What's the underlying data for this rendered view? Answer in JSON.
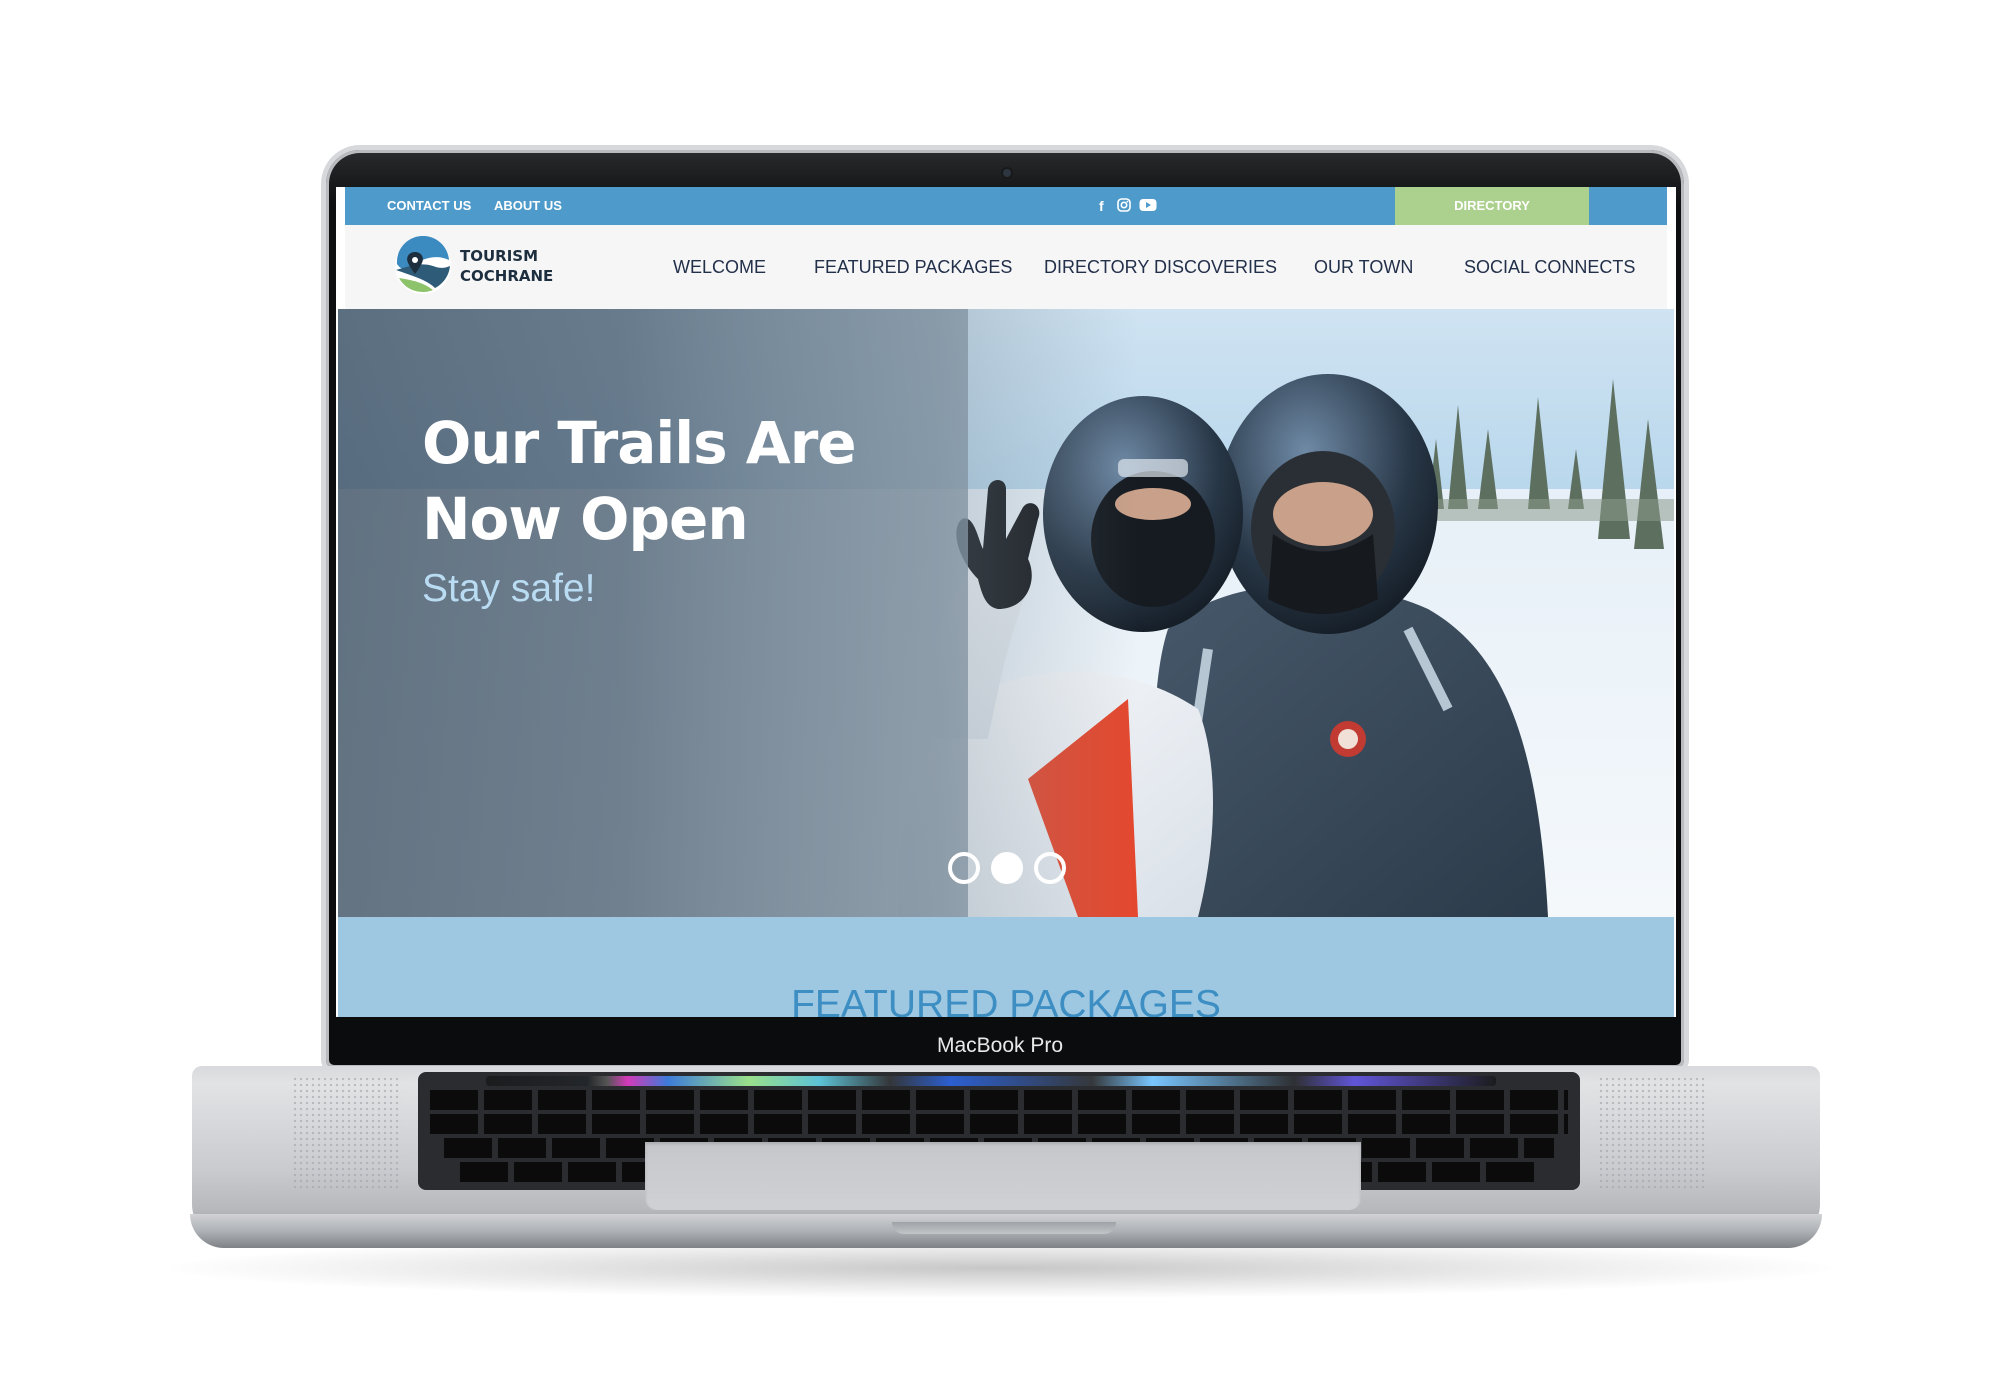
{
  "device": {
    "label": "MacBook Pro"
  },
  "topbar": {
    "links": [
      "CONTACT US",
      "ABOUT US"
    ],
    "social_icons": [
      "facebook-icon",
      "instagram-icon",
      "youtube-icon"
    ],
    "directory_label": "DIRECTORY",
    "bg_color": "#4e9bcb",
    "directory_color": "#acd08e"
  },
  "header": {
    "logo_line1": "TOURISM",
    "logo_line2": "COCHRANE",
    "nav": [
      "WELCOME",
      "FEATURED PACKAGES",
      "DIRECTORY DISCOVERIES",
      "OUR TOWN",
      "SOCIAL CONNECTS"
    ]
  },
  "hero": {
    "title_line1": "Our Trails Are",
    "title_line2": "Now Open",
    "subtitle": "Stay safe!",
    "slides": 3,
    "active_slide": 2
  },
  "featured": {
    "title": "FEATURED PACKAGES",
    "band_color": "#9ec8e2"
  }
}
